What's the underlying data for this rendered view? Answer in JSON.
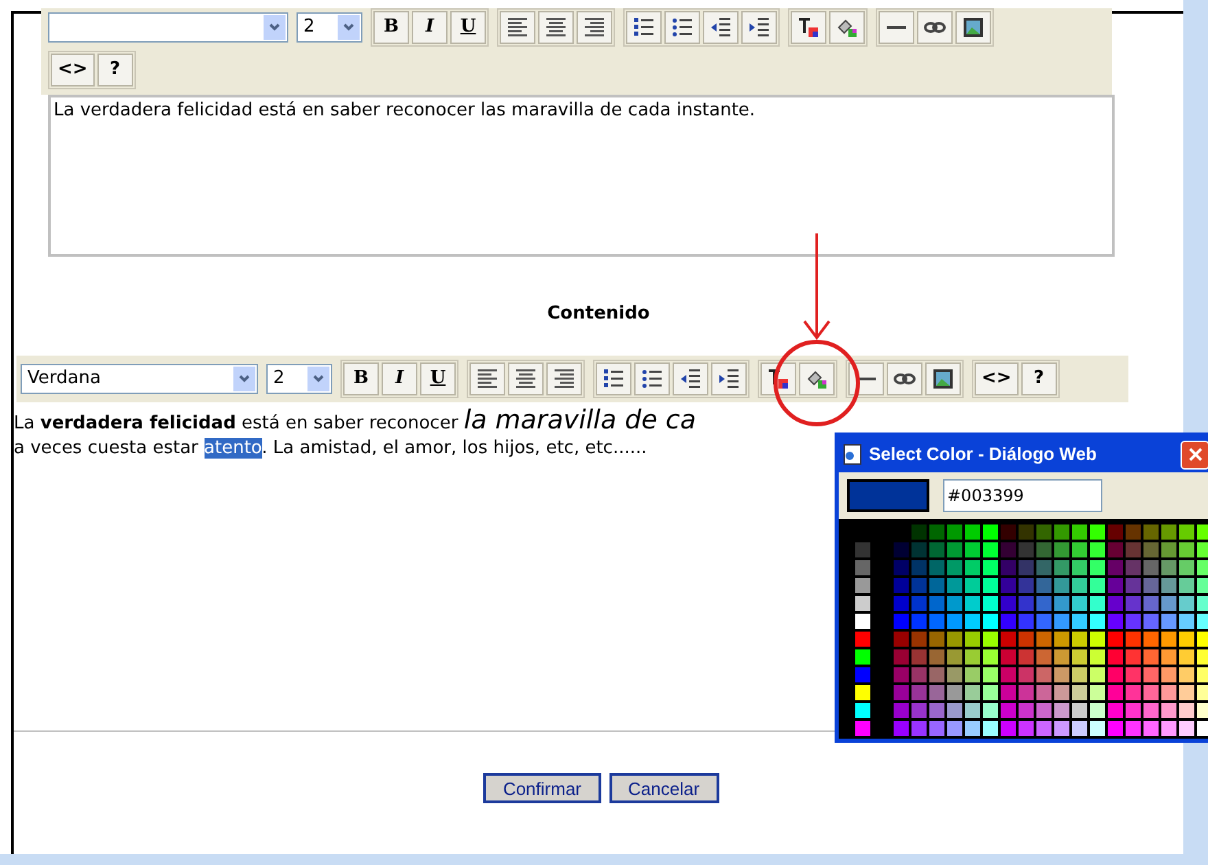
{
  "top_editor": {
    "toolbar": {
      "size": "2",
      "format_buttons": [
        "B",
        "I",
        "U"
      ],
      "extra_buttons": [
        "<>",
        "?"
      ]
    },
    "text": "La verdadera felicidad está en saber reconocer las maravilla de cada instante."
  },
  "section_title": "Contenido",
  "editor": {
    "toolbar": {
      "font": "Verdana",
      "size": "2",
      "format_buttons": [
        "B",
        "I",
        "U"
      ],
      "extra_buttons": [
        "<>",
        "?"
      ]
    },
    "line_1": "La **verdadera felicidad** está en saber reconocer *la maravilla de ca*",
    "line_2": {
      "before": "a veces cuesta estar ",
      "selection": "atento",
      "after": ". La amistad, el amor, los hijos, etc, etc......"
    }
  },
  "buttons": [
    "Confirmar",
    "Cancelar"
  ],
  "color_dialog": {
    "title": "Select Color - Diálogo Web",
    "value": "#003399"
  }
}
